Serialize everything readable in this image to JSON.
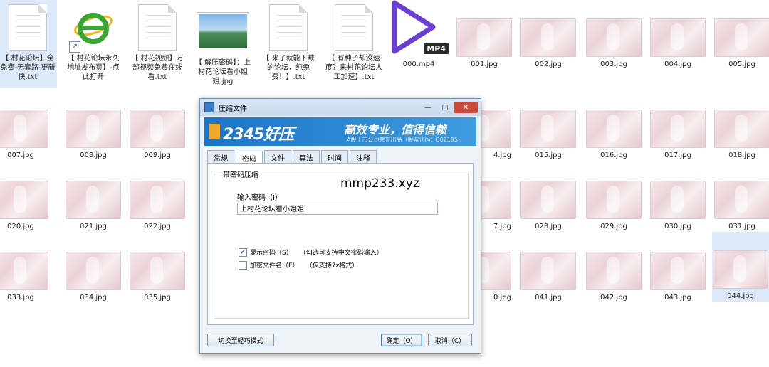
{
  "desktop_files": [
    {
      "label": "【 村花论坛】全免费-无套路-更新快.txt",
      "icon": "text-file-icon"
    },
    {
      "label": "【 村花论坛永久地址发布页】-点此打开",
      "icon": "ie-shortcut-icon"
    },
    {
      "label": "【 村花视频】万部视频免费在线看.txt",
      "icon": "text-file-icon"
    },
    {
      "label": "【 解压密码】：上村花论坛看小姐姐.jpg",
      "icon": "landscape-image-icon"
    },
    {
      "label": "【 来了就能下载的论坛，纯免费！】.txt",
      "icon": "text-file-icon"
    },
    {
      "label": "【 有种子却没速度？来村花论坛人工加速】.txt",
      "icon": "text-file-icon"
    },
    {
      "label": "000.mp4",
      "icon": "video-play-icon",
      "badge": "MP4"
    }
  ],
  "images": {
    "row1": [
      "001.jpg",
      "002.jpg",
      "003.jpg",
      "004.jpg",
      "005.jpg"
    ],
    "row2_left": [
      "007.jpg",
      "008.jpg",
      "009.jpg"
    ],
    "row2_right": [
      "4.jpg",
      "015.jpg",
      "016.jpg",
      "017.jpg",
      "018.jpg"
    ],
    "row3_left": [
      "020.jpg",
      "021.jpg",
      "022.jpg"
    ],
    "row3_right": [
      "7.jpg",
      "028.jpg",
      "029.jpg",
      "030.jpg",
      "031.jpg"
    ],
    "row4_left": [
      "033.jpg",
      "034.jpg",
      "035.jpg"
    ],
    "row4_right": [
      "0.jpg",
      "041.jpg",
      "042.jpg",
      "043.jpg",
      "044.jpg"
    ]
  },
  "dialog": {
    "title": "压缩文件",
    "banner_logo": "2345好压",
    "banner_slogan": "高效专业，值得信赖",
    "banner_sub": "A股上市公司荣誉出品（股票代码：002195）",
    "tabs": [
      "常规",
      "密码",
      "文件",
      "算法",
      "时间",
      "注释"
    ],
    "active_tab": "密码",
    "group_title": "带密码压缩",
    "password_label": "输入密码（I）",
    "password_value": "上村花论坛看小姐姐",
    "show_password": {
      "label": "显示密码（S）",
      "hint": "（勾选可支持中文密码输入）",
      "checked": true
    },
    "encrypt_names": {
      "label": "加密文件名（E）",
      "hint": "（仅支持7z格式）",
      "checked": false
    },
    "switch_mode_button": "切换至轻巧模式",
    "ok_button": "确定（O）",
    "cancel_button": "取消（C）",
    "close_symbol": "✕",
    "minimize_symbol": "—",
    "maximize_symbol": "▢"
  },
  "watermark": "mmp233.xyz"
}
